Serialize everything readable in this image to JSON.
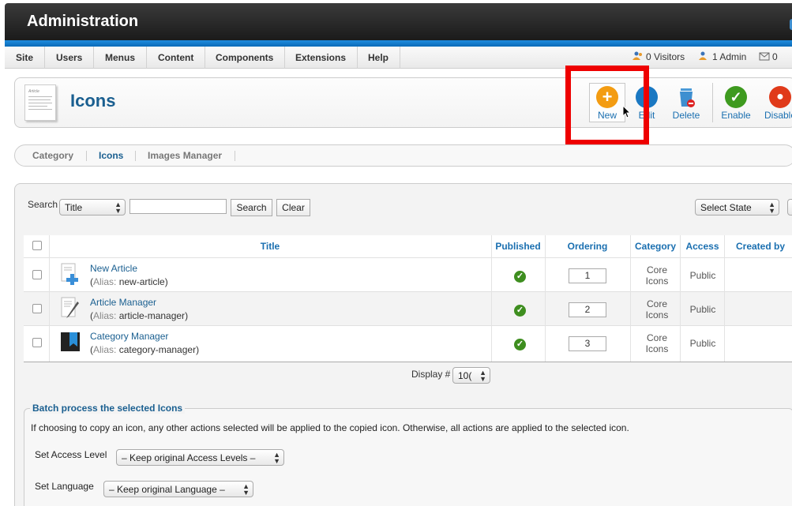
{
  "header": {
    "title": "Administration"
  },
  "menu": {
    "items": [
      "Site",
      "Users",
      "Menus",
      "Content",
      "Components",
      "Extensions",
      "Help"
    ],
    "status": {
      "visitors": "0 Visitors",
      "admins": "1 Admin",
      "messages": "0"
    }
  },
  "toolbar": {
    "page_title": "Icons",
    "page_icon_text": "Article",
    "buttons": {
      "new": "New",
      "edit": "Edit",
      "delete": "Delete",
      "enable": "Enable",
      "disable": "Disable"
    }
  },
  "subtabs": [
    "Category",
    "Icons",
    "Images Manager"
  ],
  "filters": {
    "search_label": "Search",
    "search_field_select": "Title",
    "search_button": "Search",
    "clear_button": "Clear",
    "state_select": "Select State"
  },
  "table": {
    "headers": [
      "Title",
      "Published",
      "Ordering",
      "Category",
      "Access",
      "Created by"
    ],
    "alias_prefix": "Alias:",
    "rows": [
      {
        "title": "New Article",
        "alias": "new-article",
        "ordering": "1",
        "category_line1": "Core",
        "category_line2": "Icons",
        "access": "Public"
      },
      {
        "title": "Article Manager",
        "alias": "article-manager",
        "ordering": "2",
        "category_line1": "Core",
        "category_line2": "Icons",
        "access": "Public"
      },
      {
        "title": "Category Manager",
        "alias": "category-manager",
        "ordering": "3",
        "category_line1": "Core",
        "category_line2": "Icons",
        "access": "Public"
      }
    ],
    "display_label": "Display #",
    "display_value": "10("
  },
  "batch": {
    "title": "Batch process the selected Icons",
    "description": "If choosing to copy an icon, any other actions selected will be applied to the copied icon. Otherwise, all actions are applied to the selected icon.",
    "access_label": "Set Access Level",
    "access_value": "– Keep original Access Levels –",
    "language_label": "Set Language",
    "language_value": "– Keep original Language –"
  },
  "colors": {
    "accent_blue": "#1a5f90",
    "highlight_red": "#ee0000",
    "new_orange": "#f39c12",
    "enable_green": "#3e8e1f"
  }
}
